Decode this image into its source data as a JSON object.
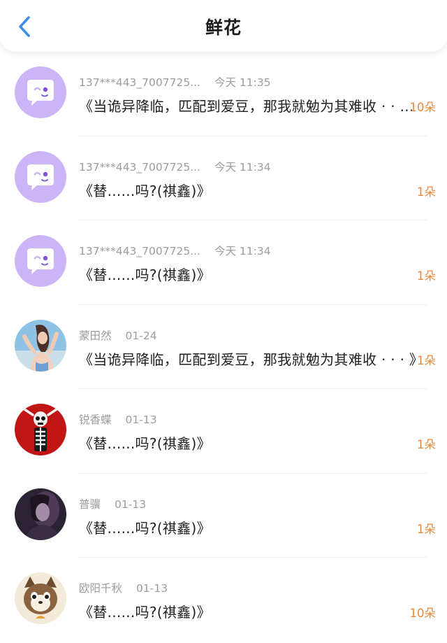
{
  "header": {
    "title": "鲜花",
    "back_icon": "chevron-left-icon",
    "accent": "#3d8ee8"
  },
  "colors": {
    "count": "#e8893a",
    "meta": "#9c9c9c",
    "default_avatar_bg": "#cbb5f7"
  },
  "items": [
    {
      "user": "137***443_7007725...",
      "time": "今天 11:35",
      "message": "《当诡异降临，匹配到爱豆，那我就勉为其难收 · · ...",
      "count": "10朵",
      "avatar": "chat-bubble-icon"
    },
    {
      "user": "137***443_7007725...",
      "time": "今天 11:34",
      "message": "《替......吗?(祺鑫)》",
      "count": "1朵",
      "avatar": "chat-bubble-icon"
    },
    {
      "user": "137***443_7007725...",
      "time": "今天 11:34",
      "message": "《替......吗?(祺鑫)》",
      "count": "1朵",
      "avatar": "chat-bubble-icon"
    },
    {
      "user": "蒙田然",
      "time": "01-24",
      "message": "《当诡异降临，匹配到爱豆，那我就勉为其难收 · · · 》",
      "count": "1朵",
      "avatar": "user-photo"
    },
    {
      "user": "锐香蝶",
      "time": "01-13",
      "message": "《替......吗?(祺鑫)》",
      "count": "1朵",
      "avatar": "skeleton-photo"
    },
    {
      "user": "普骥",
      "time": "01-13",
      "message": "《替......吗?(祺鑫)》",
      "count": "1朵",
      "avatar": "user-photo"
    },
    {
      "user": "欧阳千秋",
      "time": "01-13",
      "message": "《替......吗?(祺鑫)》",
      "count": "10朵",
      "avatar": "cat-photo"
    }
  ]
}
